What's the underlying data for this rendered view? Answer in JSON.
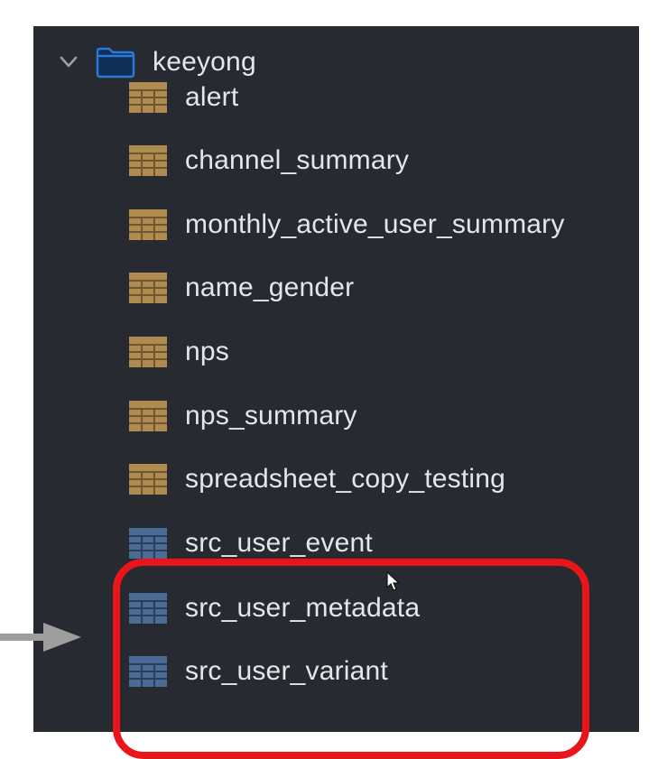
{
  "tree": {
    "root": {
      "label": "keeyong",
      "icon": "folder-icon",
      "expanded": true
    },
    "items": [
      {
        "label": "alert",
        "icon": "table-icon",
        "kind": "table"
      },
      {
        "label": "channel_summary",
        "icon": "table-icon",
        "kind": "table"
      },
      {
        "label": "monthly_active_user_summary",
        "icon": "table-icon",
        "kind": "table"
      },
      {
        "label": "name_gender",
        "icon": "table-icon",
        "kind": "table"
      },
      {
        "label": "nps",
        "icon": "table-icon",
        "kind": "table"
      },
      {
        "label": "nps_summary",
        "icon": "table-icon",
        "kind": "table"
      },
      {
        "label": "spreadsheet_copy_testing",
        "icon": "table-icon",
        "kind": "table"
      },
      {
        "label": "src_user_event",
        "icon": "external-table-icon",
        "kind": "external"
      },
      {
        "label": "src_user_metadata",
        "icon": "external-table-icon",
        "kind": "external"
      },
      {
        "label": "src_user_variant",
        "icon": "external-table-icon",
        "kind": "external"
      }
    ]
  },
  "colors": {
    "panel_bg": "#272a30",
    "text": "#e4e6ea",
    "table_icon": "#b08b4f",
    "external_table_icon": "#4a6b95",
    "folder": "#2a79d6",
    "highlight": "#e8161a",
    "arrow": "#9e9e9e"
  }
}
